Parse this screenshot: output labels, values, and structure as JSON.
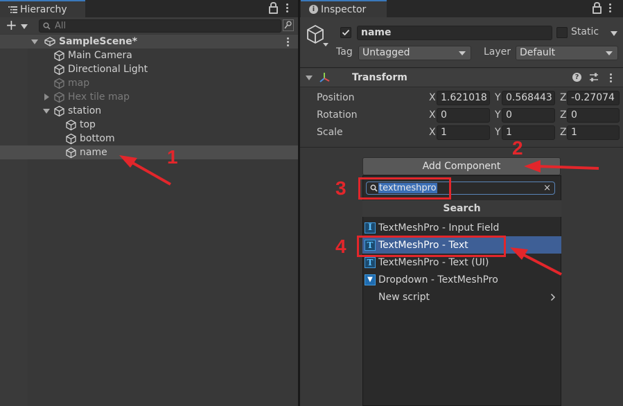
{
  "hierarchy": {
    "tab_label": "Hierarchy",
    "add_button": "+",
    "search_placeholder": "All",
    "scene": "SampleScene*",
    "items": [
      {
        "label": "Main Camera",
        "state": "normal"
      },
      {
        "label": "Directional Light",
        "state": "normal"
      },
      {
        "label": "map",
        "state": "disabled"
      },
      {
        "label": "Hex tile map",
        "state": "disabled"
      },
      {
        "label": "station",
        "state": "normal"
      },
      {
        "label": "top",
        "state": "normal"
      },
      {
        "label": "bottom",
        "state": "normal"
      },
      {
        "label": "name",
        "state": "selected"
      }
    ]
  },
  "inspector": {
    "tab_label": "Inspector",
    "object_name": "name",
    "static_label": "Static",
    "tag_label": "Tag",
    "tag_value": "Untagged",
    "layer_label": "Layer",
    "layer_value": "Default",
    "transform": {
      "title": "Transform",
      "rows": [
        {
          "label": "Position",
          "x": "1.621018",
          "y": "0.568443",
          "z": "-0.27074"
        },
        {
          "label": "Rotation",
          "x": "0",
          "y": "0",
          "z": "0"
        },
        {
          "label": "Scale",
          "x": "1",
          "y": "1",
          "z": "1"
        }
      ],
      "axis_x": "X",
      "axis_y": "Y",
      "axis_z": "Z"
    },
    "add_component_label": "Add Component",
    "popup": {
      "search_value": "textmeshpro",
      "search_title": "Search",
      "items": [
        {
          "label": "TextMeshPro - Input Field",
          "icon": "tmp-input-field-icon"
        },
        {
          "label": "TextMeshPro - Text",
          "icon": "tmp-text-icon",
          "highlighted": true
        },
        {
          "label": "TextMeshPro - Text (UI)",
          "icon": "tmp-text-ui-icon"
        },
        {
          "label": "Dropdown - TextMeshPro",
          "icon": "tmp-dropdown-icon"
        },
        {
          "label": "New script",
          "icon": "chevron-right-icon"
        }
      ]
    }
  },
  "annotations": {
    "step1": "1",
    "step2": "2",
    "step3": "3",
    "step4": "4",
    "color": "#e3262b"
  },
  "colors": {
    "selection": "#3e5f96",
    "accent": "#3a79bb"
  }
}
